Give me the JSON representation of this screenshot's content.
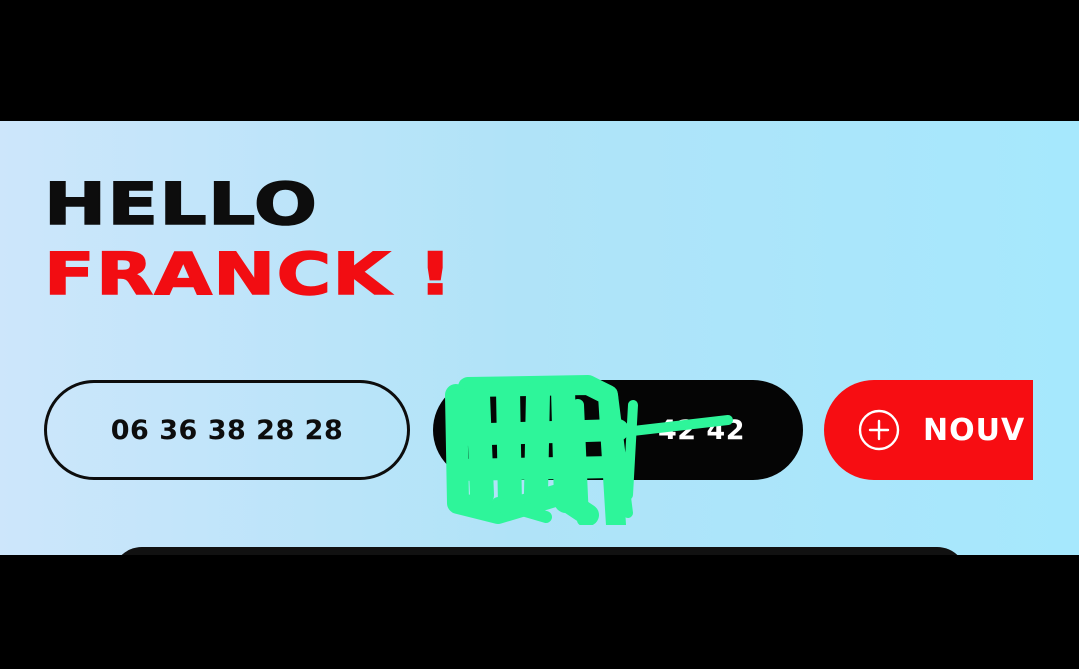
{
  "greeting": {
    "line1": "HELLO",
    "line2": "FRANCK !"
  },
  "actions": {
    "phone_label": "06 36 38 28 28",
    "second_label_partial": "42 42",
    "new_label": "NOUV"
  },
  "icons": {
    "new_button_icon": "plus-circle-icon"
  },
  "colors": {
    "accent_red": "#f70d12",
    "dark": "#050505",
    "background_light": "#cde6fb",
    "background_cyan": "#a6e8fd",
    "redaction_green": "#2ef59a"
  }
}
